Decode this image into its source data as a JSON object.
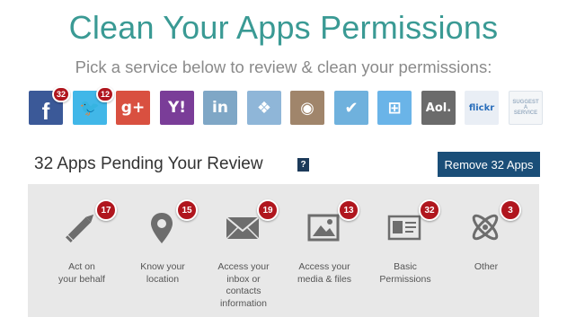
{
  "header": {
    "title": "Clean Your Apps Permissions",
    "subtitle": "Pick a service below to review & clean your permissions:"
  },
  "services": [
    {
      "name": "facebook",
      "icon": "facebook-icon",
      "glyph": "f",
      "color": "#3b5998",
      "badge": "32"
    },
    {
      "name": "twitter",
      "icon": "twitter-icon",
      "glyph": "🐦",
      "color": "#41b7e8",
      "badge": "12"
    },
    {
      "name": "google-plus",
      "icon": "google-plus-icon",
      "glyph": "g+",
      "color": "#d95040",
      "badge": ""
    },
    {
      "name": "yahoo",
      "icon": "yahoo-icon",
      "glyph": "Y!",
      "color": "#7a3d98",
      "badge": ""
    },
    {
      "name": "linkedin",
      "icon": "linkedin-icon",
      "glyph": "in",
      "color": "#7fa7c6",
      "badge": ""
    },
    {
      "name": "dropbox",
      "icon": "dropbox-icon",
      "glyph": "❖",
      "color": "#8fb6d8",
      "badge": ""
    },
    {
      "name": "instagram",
      "icon": "instagram-icon",
      "glyph": "◉",
      "color": "#a0856b",
      "badge": ""
    },
    {
      "name": "foursquare",
      "icon": "foursquare-icon",
      "glyph": "✔",
      "color": "#6fb1dd",
      "badge": ""
    },
    {
      "name": "windows",
      "icon": "windows-icon",
      "glyph": "⊞",
      "color": "#6ab4e8",
      "badge": ""
    },
    {
      "name": "aol",
      "icon": "aol-icon",
      "glyph": "Aol.",
      "color": "#6b6b6b",
      "badge": ""
    },
    {
      "name": "flickr",
      "icon": "flickr-icon",
      "glyph": "flickr",
      "color": "#e9eef5",
      "badge": ""
    },
    {
      "name": "suggest",
      "icon": "suggest-icon",
      "glyph": "SUGGEST A SERVICE",
      "color": "#f4f6f8",
      "badge": ""
    }
  ],
  "review": {
    "title": "32 Apps Pending Your Review",
    "help": "?",
    "remove_label": "Remove 32 Apps"
  },
  "permissions": [
    {
      "icon": "pencil-icon",
      "label": "Act on\nyour behalf",
      "badge": "17"
    },
    {
      "icon": "location-pin-icon",
      "label": "Know your\nlocation",
      "badge": "15"
    },
    {
      "icon": "envelope-icon",
      "label": "Access your\ninbox or\ncontacts\ninformation",
      "badge": "19"
    },
    {
      "icon": "image-icon",
      "label": "Access your\nmedia & files",
      "badge": "13"
    },
    {
      "icon": "id-card-icon",
      "label": "Basic\nPermissions",
      "badge": "32"
    },
    {
      "icon": "atom-icon",
      "label": "Other",
      "badge": "3"
    }
  ]
}
